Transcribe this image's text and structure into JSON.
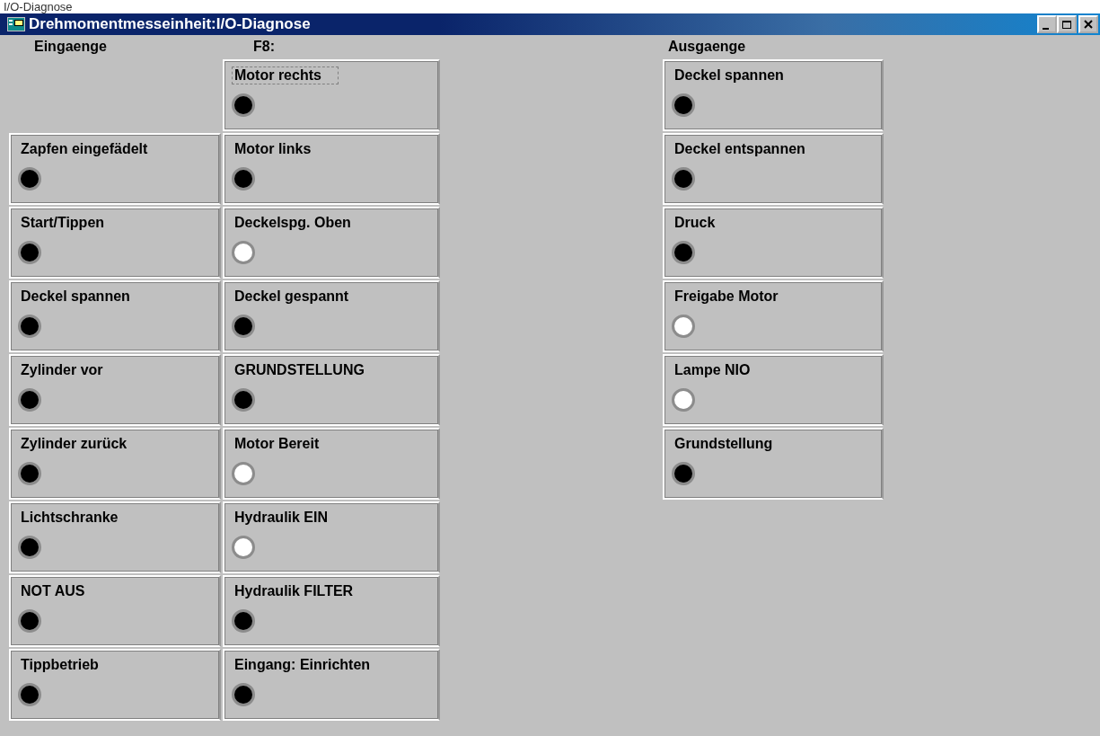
{
  "caption": "I/O-Diagnose",
  "window": {
    "title": "Drehmomentmesseinheit:I/O-Diagnose"
  },
  "columns": [
    {
      "heading": "Eingaenge",
      "offset": true,
      "signals": [
        {
          "label": "Zapfen eingefädelt",
          "lit": false,
          "focused": false
        },
        {
          "label": "Start/Tippen",
          "lit": false,
          "focused": false
        },
        {
          "label": "Deckel spannen",
          "lit": false,
          "focused": false
        },
        {
          "label": "Zylinder vor",
          "lit": false,
          "focused": false
        },
        {
          "label": "Zylinder zurück",
          "lit": false,
          "focused": false
        },
        {
          "label": "Lichtschranke",
          "lit": false,
          "focused": false
        },
        {
          "label": "NOT AUS",
          "lit": false,
          "focused": false
        },
        {
          "label": "Tippbetrieb",
          "lit": false,
          "focused": false
        }
      ]
    },
    {
      "heading": "F8:",
      "offset": false,
      "signals": [
        {
          "label": "Motor rechts",
          "lit": false,
          "focused": true
        },
        {
          "label": "Motor links",
          "lit": false,
          "focused": false
        },
        {
          "label": "Deckelspg. Oben",
          "lit": true,
          "focused": false
        },
        {
          "label": "Deckel gespannt",
          "lit": false,
          "focused": false
        },
        {
          "label": "GRUNDSTELLUNG",
          "lit": false,
          "focused": false
        },
        {
          "label": "Motor Bereit",
          "lit": true,
          "focused": false
        },
        {
          "label": "Hydraulik EIN",
          "lit": true,
          "focused": false
        },
        {
          "label": "Hydraulik FILTER",
          "lit": false,
          "focused": false
        },
        {
          "label": "Eingang: Einrichten",
          "lit": false,
          "focused": false
        }
      ]
    },
    {
      "heading": "Ausgaenge",
      "offset": false,
      "signals": [
        {
          "label": "Deckel spannen",
          "lit": false,
          "focused": false
        },
        {
          "label": "Deckel entspannen",
          "lit": false,
          "focused": false
        },
        {
          "label": "Druck",
          "lit": false,
          "focused": false
        },
        {
          "label": "Freigabe Motor",
          "lit": true,
          "focused": false
        },
        {
          "label": "Lampe NIO",
          "lit": true,
          "focused": false
        },
        {
          "label": "Grundstellung",
          "lit": false,
          "focused": false
        }
      ]
    }
  ]
}
